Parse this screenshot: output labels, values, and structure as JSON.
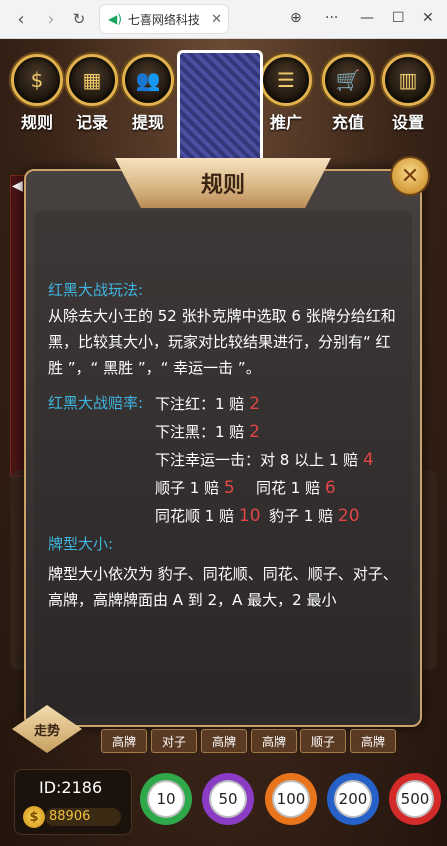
{
  "browser": {
    "tab_title": "七喜网络科技",
    "back": "‹",
    "forward": "›",
    "reload": "↻",
    "close_tab": "✕",
    "globe": "⊕",
    "more": "···",
    "minimize": "—",
    "maximize": "☐",
    "close_window": "✕"
  },
  "top_nav": {
    "rules": "规则",
    "records": "记录",
    "withdraw": "提现",
    "promote": "推广",
    "recharge": "充值",
    "settings": "设置"
  },
  "dialog": {
    "title": "规则",
    "close": "✕",
    "section1_heading": "红黑大战玩法:",
    "section1_text": "从除去大小王的 52 张扑克牌中选取 6 张牌分给红和黑，比较其大小，玩家对比较结果进行，分别有“ 红胜 ”，“ 黑胜 ”，“ 幸运一击 ”。",
    "section2_heading": "红黑大战赔率:",
    "odds": {
      "bet_red": "下注红：1 赔",
      "bet_red_val": "2",
      "bet_black": "下注黑：1 赔",
      "bet_black_val": "2",
      "bet_lucky": "下注幸运一击：对 8 以上 1 赔",
      "bet_lucky_val": "4",
      "straight": "顺子 1 赔",
      "straight_val": "5",
      "flush": "同花 1 赔",
      "flush_val": "6",
      "straight_flush": "同花顺 1 赔",
      "straight_flush_val": "10",
      "triple": "豹子 1 赔",
      "triple_val": "20"
    },
    "section3_heading": "牌型大小:",
    "section3_text": "牌型大小依次为 豹子、同花顺、同花、顺子、对子、高牌，高牌牌面由 A 到 2，A 最大，2 最小"
  },
  "history": [
    "高牌",
    "对子",
    "高牌",
    "高牌",
    "顺子",
    "高牌"
  ],
  "walk_badge": "走势",
  "player": {
    "id": "ID:2186",
    "gold": "88906"
  },
  "chips": [
    {
      "value": "10",
      "color": "#2fa84a"
    },
    {
      "value": "50",
      "color": "#8a3cc4"
    },
    {
      "value": "100",
      "color": "#e8741c"
    },
    {
      "value": "200",
      "color": "#2660c9"
    },
    {
      "value": "500",
      "color": "#d42a2a"
    }
  ],
  "colors": {
    "accent_blue": "#3fb6e0",
    "odds_red": "#e04646",
    "gold_border": "#c9a36a"
  }
}
